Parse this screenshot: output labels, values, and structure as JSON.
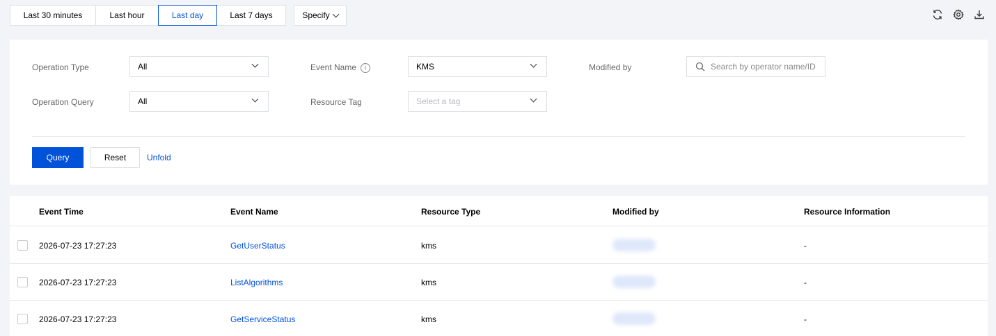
{
  "time_range": {
    "options": [
      "Last 30 minutes",
      "Last hour",
      "Last day",
      "Last 7 days"
    ],
    "active_index": 2,
    "specify_label": "Specify"
  },
  "top_icons": [
    "refresh-icon",
    "gear-icon",
    "download-icon"
  ],
  "filters": {
    "operation_type": {
      "label": "Operation Type",
      "value": "All"
    },
    "event_name": {
      "label": "Event Name",
      "value": "KMS"
    },
    "modified_by": {
      "label": "Modified by",
      "placeholder": "Search by operator name/ID"
    },
    "operation_query": {
      "label": "Operation Query",
      "value": "All"
    },
    "resource_tag": {
      "label": "Resource Tag",
      "placeholder": "Select a tag"
    }
  },
  "actions": {
    "query": "Query",
    "reset": "Reset",
    "unfold": "Unfold"
  },
  "table": {
    "columns": [
      "Event Time",
      "Event Name",
      "Resource Type",
      "Modified by",
      "Resource Information"
    ],
    "rows": [
      {
        "event_time": "2026-07-23 17:27:23",
        "event_name": "GetUserStatus",
        "resource_type": "kms",
        "resource_info": "-"
      },
      {
        "event_time": "2026-07-23 17:27:23",
        "event_name": "ListAlgorithms",
        "resource_type": "kms",
        "resource_info": "-"
      },
      {
        "event_time": "2026-07-23 17:27:23",
        "event_name": "GetServiceStatus",
        "resource_type": "kms",
        "resource_info": "-"
      }
    ]
  },
  "colors": {
    "accent": "#0052d9",
    "border": "#dcdfe6",
    "background": "#f3f4f7"
  }
}
